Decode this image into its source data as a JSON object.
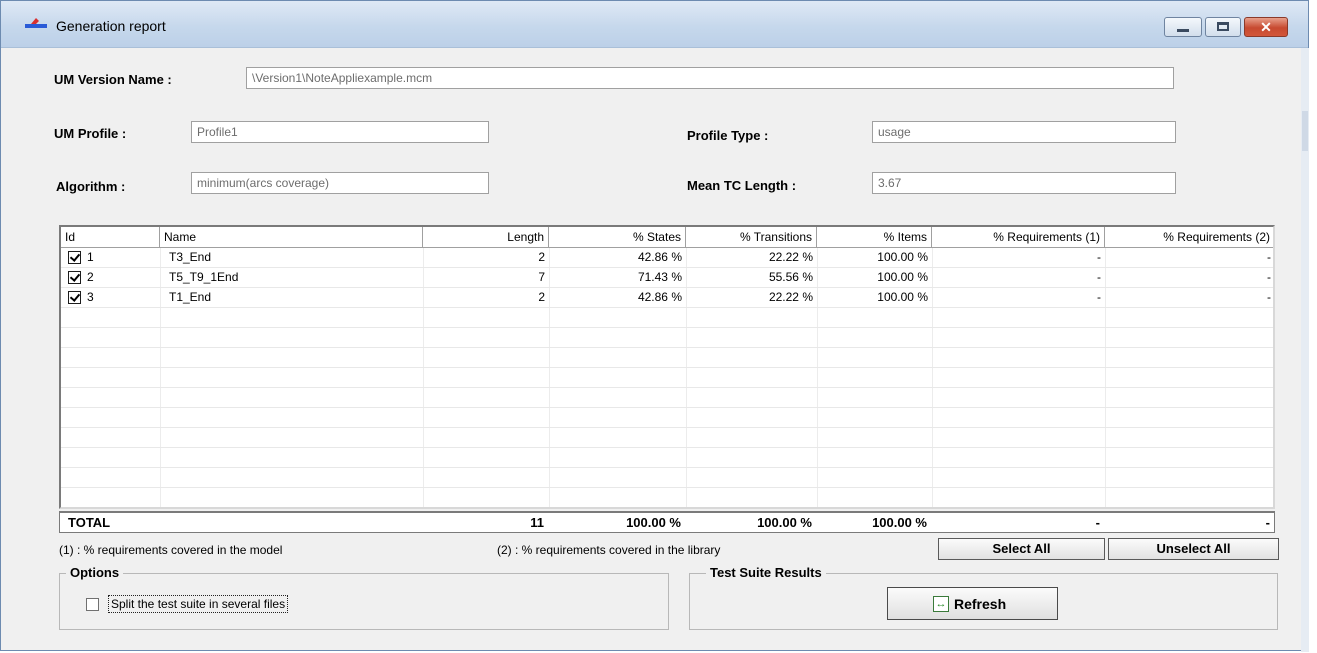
{
  "window": {
    "title": "Generation report",
    "controls": {
      "minimize": "",
      "maximize": "",
      "close": "✕"
    }
  },
  "form": {
    "um_version_label": "UM Version Name :",
    "um_version_value": "\\Version1\\NoteAppliexample.mcm",
    "um_profile_label": "UM Profile :",
    "um_profile_value": "Profile1",
    "profile_type_label": "Profile Type :",
    "profile_type_value": "usage",
    "algorithm_label": "Algorithm :",
    "algorithm_value": "minimum(arcs coverage)",
    "mean_tc_label": "Mean TC Length :",
    "mean_tc_value": "3.67"
  },
  "table": {
    "columns": [
      "Id",
      "Name",
      "Length",
      "% States",
      "% Transitions",
      "% Items",
      "% Requirements (1)",
      "% Requirements (2)"
    ],
    "rows": [
      {
        "checked": true,
        "id": "1",
        "name": "T3_End",
        "length": "2",
        "states": "42.86 %",
        "transitions": "22.22 %",
        "items": "100.00 %",
        "req1": "-",
        "req2": "-"
      },
      {
        "checked": true,
        "id": "2",
        "name": "T5_T9_1End",
        "length": "7",
        "states": "71.43 %",
        "transitions": "55.56 %",
        "items": "100.00 %",
        "req1": "-",
        "req2": "-"
      },
      {
        "checked": true,
        "id": "3",
        "name": "T1_End",
        "length": "2",
        "states": "42.86 %",
        "transitions": "22.22 %",
        "items": "100.00 %",
        "req1": "-",
        "req2": "-"
      }
    ],
    "total": {
      "label": "TOTAL",
      "length": "11",
      "states": "100.00 %",
      "transitions": "100.00 %",
      "items": "100.00 %",
      "req1": "-",
      "req2": "-"
    }
  },
  "notes": {
    "req1": "(1) : % requirements covered in the model",
    "req2": "(2) : % requirements covered in the library"
  },
  "buttons": {
    "select_all": "Select All",
    "unselect_all": "Unselect All"
  },
  "options": {
    "title": "Options",
    "split_label": "Split the test suite in several files",
    "split_checked": false
  },
  "results": {
    "title": "Test Suite Results",
    "refresh_label": "Refresh"
  },
  "icons": {
    "app": "app-icon",
    "refresh": "refresh-icon"
  }
}
